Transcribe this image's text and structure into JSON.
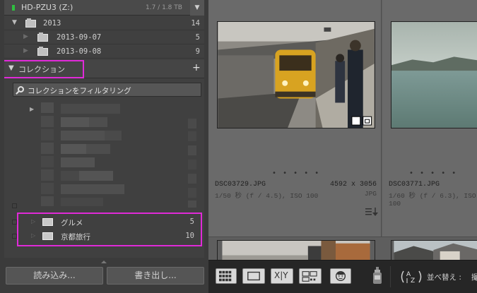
{
  "drive": {
    "name": "HD-PZU3 (Z:)",
    "capacity": "1.7 / 1.8 TB",
    "led_color": "#2fbf3f"
  },
  "folders": [
    {
      "label": "2013",
      "count": "14"
    },
    {
      "label": "2013-09-07",
      "count": "5"
    },
    {
      "label": "2013-09-08",
      "count": "9"
    }
  ],
  "collections": {
    "title": "コレクション",
    "add_glyph": "+",
    "filter_placeholder": "コレクションをフィルタリング",
    "items": [
      {
        "label": "グルメ",
        "count": "5"
      },
      {
        "label": "京都旅行",
        "count": "10"
      }
    ]
  },
  "buttons": {
    "import": "読み込み...",
    "export": "書き出し..."
  },
  "thumbnails": [
    {
      "filename": "DSC03729.JPG",
      "dimensions": "4592 x 3056",
      "exposure": "1/50 秒 (f / 4.5), ISO 100",
      "ext": "JPG",
      "dots": "• • • • •"
    },
    {
      "filename": "DSC03771.JPG",
      "dimensions": "",
      "exposure": "1/60 秒 (f / 6.3), ISO 100",
      "ext": "",
      "dots": "• • • • •"
    }
  ],
  "toolbar": {
    "sort_label": "並べ替え :",
    "sort_value": "撮",
    "compare_label": "X|Y"
  },
  "colors": {
    "highlight": "#e02ad8",
    "panel": "#404040",
    "grid": "#5e5e5e"
  }
}
